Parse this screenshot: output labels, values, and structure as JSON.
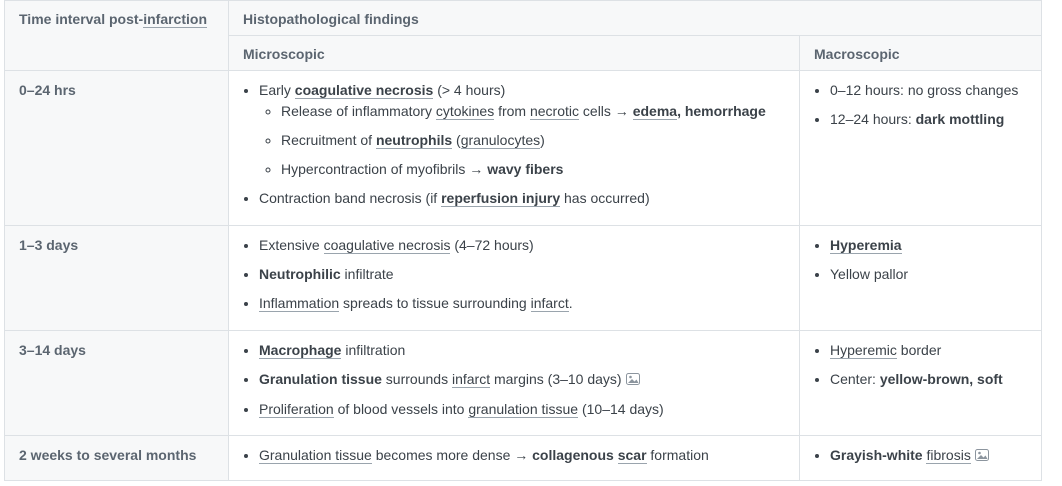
{
  "header": {
    "time_col": "Time interval post-infarction",
    "findings": "Histopathological findings",
    "microscopic": "Microscopic",
    "macroscopic": "Macroscopic"
  },
  "rows": [
    {
      "time": "0–24 hrs",
      "micro": {
        "l1": {
          "a": "Early ",
          "b": "coagulative necrosis",
          "c": " (> 4 hours)"
        },
        "l1a": {
          "a": "Release of inflammatory ",
          "b": "cytokines",
          "c": " from ",
          "d": "necrotic",
          "e": " cells → ",
          "f": "edema",
          "g": ", ",
          "h": "hemorrhage"
        },
        "l1b": {
          "a": "Recruitment of ",
          "b": "neutrophils",
          "c": " (",
          "d": "granulocytes",
          "e": ")"
        },
        "l1c": {
          "a": "Hypercontraction of myofibrils → ",
          "b": "wavy fibers"
        },
        "l2": {
          "a": "Contraction band necrosis (if ",
          "b": "reperfusion injury",
          "c": " has occurred)"
        }
      },
      "macro": {
        "l1": "0–12 hours: no gross changes",
        "l2": {
          "a": "12–24 hours: ",
          "b": "dark mottling"
        }
      }
    },
    {
      "time": "1–3 days",
      "micro": {
        "l1": {
          "a": "Extensive ",
          "b": "coagulative necrosis",
          "c": " (4–72 hours)"
        },
        "l2": {
          "a": "Neutrophilic",
          "b": " infiltrate"
        },
        "l3": {
          "a": "Inflammation",
          "b": " spreads to tissue surrounding ",
          "c": "infarct",
          "d": "."
        }
      },
      "macro": {
        "l1": "Hyperemia",
        "l2": "Yellow pallor"
      }
    },
    {
      "time": "3–14 days",
      "micro": {
        "l1": {
          "a": "Macrophage",
          "b": " infiltration"
        },
        "l2": {
          "a": "Granulation tissue",
          "b": " surrounds ",
          "c": "infarct",
          "d": " margins (3–10 days)"
        },
        "l3": {
          "a": "Proliferation",
          "b": " of blood vessels into ",
          "c": "granulation tissue",
          "d": " (10–14 days)"
        }
      },
      "macro": {
        "l1": {
          "a": "Hyperemic",
          "b": " border"
        },
        "l2": {
          "a": "Center: ",
          "b": "yellow-brown",
          "c": ", ",
          "d": "soft"
        }
      }
    },
    {
      "time": "2 weeks to several months",
      "micro": {
        "l1": {
          "a": "Granulation tissue",
          "b": " becomes more dense → ",
          "c": "collagenous",
          "d": " ",
          "e": "scar",
          "f": " formation"
        }
      },
      "macro": {
        "l1": {
          "a": "Grayish-white",
          "b": " ",
          "c": "fibrosis"
        }
      }
    }
  ]
}
